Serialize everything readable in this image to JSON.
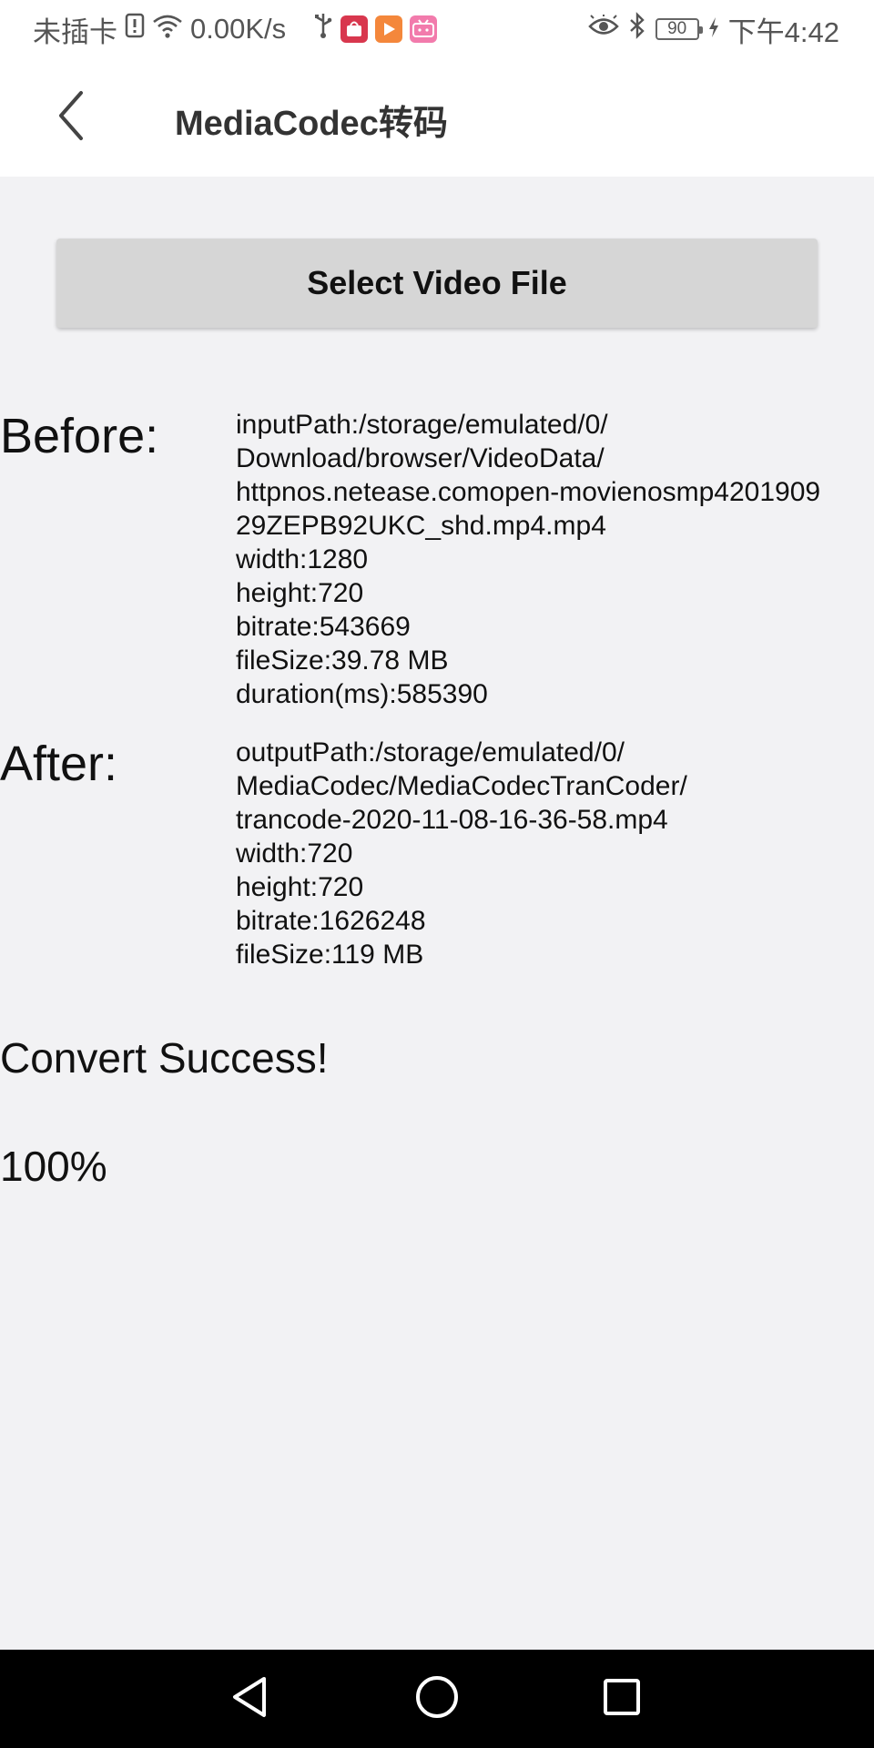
{
  "status_bar": {
    "carrier": "未插卡",
    "net_speed": "0.00K/s",
    "battery": "90",
    "time": "下午4:42"
  },
  "header": {
    "title": "MediaCodec转码"
  },
  "select_button": {
    "label": "Select Video File"
  },
  "before": {
    "label": "Before:",
    "lines": [
      "inputPath:/storage/emulated/0/",
      "Download/browser/VideoData/",
      "httpnos.netease.comopen-movienosmp4201909",
      "29ZEPB92UKC_shd.mp4.mp4",
      "width:1280",
      "height:720",
      "bitrate:543669",
      "fileSize:39.78 MB",
      "duration(ms):585390"
    ]
  },
  "after": {
    "label": "After:",
    "lines": [
      "outputPath:/storage/emulated/0/",
      "MediaCodec/MediaCodecTranCoder/",
      "trancode-2020-11-08-16-36-58.mp4",
      "width:720",
      "height:720",
      "bitrate:1626248",
      "fileSize:119 MB"
    ]
  },
  "result": {
    "message": "Convert Success!",
    "progress": "100%"
  }
}
